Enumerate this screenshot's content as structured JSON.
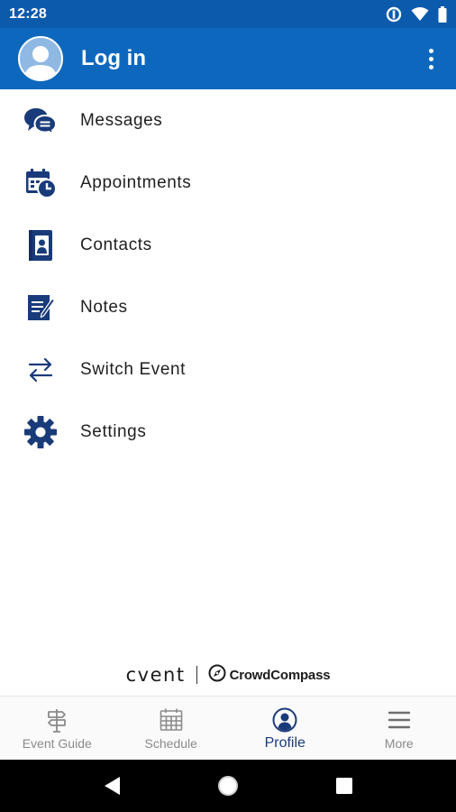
{
  "status_bar": {
    "time": "12:28",
    "icons": [
      "data-saver-icon",
      "wifi-icon",
      "battery-icon"
    ]
  },
  "app_bar": {
    "title": "Log in",
    "avatar_icon": "user-avatar-icon",
    "overflow_icon": "more-vert-icon"
  },
  "menu": {
    "items": [
      {
        "label": "Messages",
        "icon": "messages-icon"
      },
      {
        "label": "Appointments",
        "icon": "calendar-clock-icon"
      },
      {
        "label": "Contacts",
        "icon": "contact-book-icon"
      },
      {
        "label": "Notes",
        "icon": "notes-icon"
      },
      {
        "label": "Switch Event",
        "icon": "switch-arrows-icon"
      },
      {
        "label": "Settings",
        "icon": "gear-icon"
      }
    ]
  },
  "branding": {
    "cvent": "cvent",
    "crowdcompass": "CrowdCompass"
  },
  "bottom_nav": {
    "tabs": [
      {
        "label": "Event Guide",
        "icon": "signpost-icon",
        "active": false
      },
      {
        "label": "Schedule",
        "icon": "calendar-grid-icon",
        "active": false
      },
      {
        "label": "Profile",
        "icon": "profile-icon",
        "active": true
      },
      {
        "label": "More",
        "icon": "hamburger-menu-icon",
        "active": false
      }
    ]
  },
  "colors": {
    "status_bar": "#0c5aab",
    "app_bar": "#0d68bd",
    "icon_navy": "#1a3b7a",
    "active_tab": "#1a3b7a",
    "inactive_tab": "#8a8a8a"
  }
}
